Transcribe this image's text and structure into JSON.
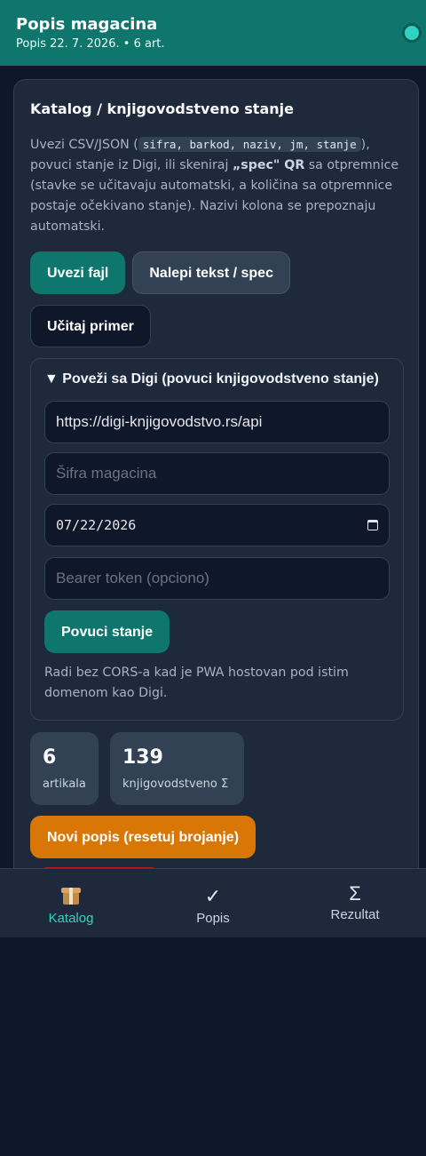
{
  "header": {
    "title": "Popis magacina",
    "subtitle": "Popis 22. 7. 2026. • 6 art.",
    "status_color": "#2dd4bf"
  },
  "catalog": {
    "title": "Katalog / knjigovodstveno stanje",
    "desc_1": "Uvezi CSV/JSON (",
    "desc_code": "sifra, barkod, naziv, jm, stanje",
    "desc_2": "), povuci stanje iz Digi, ili skeniraj ",
    "desc_bold": "„spec\" QR",
    "desc_3": " sa otpremnice (stavke se učitavaju automatski, a količina sa otpremnice postaje očekivano stanje). Nazivi kolona se prepoznaju automatski.",
    "import_label": "Uvezi fajl",
    "paste_label": "Nalepi tekst / spec",
    "sample_label": "Učitaj primer"
  },
  "digi": {
    "summary": "▼ Poveži sa Digi (povuci knjigovodstveno stanje)",
    "url_value": "https://digi-knjigovodstvo.rs/api",
    "warehouse_placeholder": "Šifra magacina",
    "date_value": "07/22/2026",
    "token_placeholder": "Bearer token (opciono)",
    "pull_label": "Povuci stanje",
    "note": "Radi bez CORS-a kad je PWA hostovan pod istim domenom kao Digi."
  },
  "stats": {
    "articles_count": "6",
    "articles_label": "artikala",
    "book_total": "139",
    "book_label": "knjigovodstveno Σ"
  },
  "actions": {
    "new_count_label": "Novi popis (resetuj brojanje)"
  },
  "nav": {
    "items": [
      {
        "label": "Katalog",
        "icon": "box-icon",
        "glyph": ""
      },
      {
        "label": "Popis",
        "icon": "check-icon",
        "glyph": "✓"
      },
      {
        "label": "Rezultat",
        "icon": "sigma-icon",
        "glyph": "Σ"
      }
    ]
  },
  "colors": {
    "accent": "#0f766e",
    "accent_light": "#2dd4bf",
    "warning": "#d97706",
    "danger": "#b91c1c",
    "background": "#0f172a",
    "surface": "#1e293b"
  }
}
